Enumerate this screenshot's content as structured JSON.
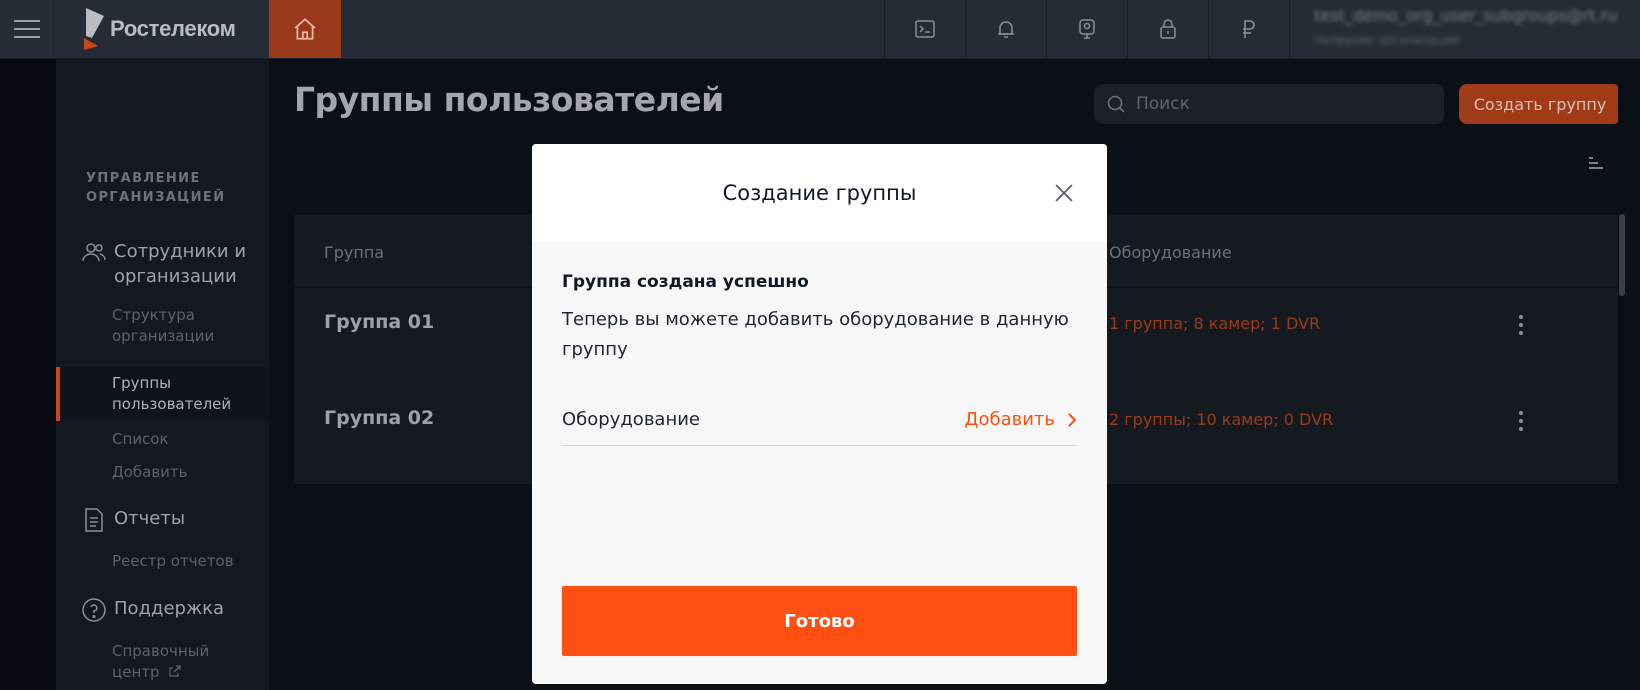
{
  "header": {
    "brand": "Ростелеком",
    "user_name": "test_demo_org_user_subgroups@rt.ru",
    "user_org": "Название организации",
    "icons": [
      "terminal-icon",
      "bell-icon",
      "camera-icon",
      "lock-icon",
      "ruble-icon"
    ]
  },
  "sidebar": {
    "section_title": "Управление организацией",
    "groups": [
      {
        "label": "Сотрудники и организации",
        "icon": "users-icon",
        "items": [
          {
            "label": "Структура организации"
          },
          {
            "label": "Группы пользователей",
            "active": true
          },
          {
            "label": "Список"
          },
          {
            "label": "Добавить"
          }
        ]
      },
      {
        "label": "Отчеты",
        "icon": "document-icon",
        "items": [
          {
            "label": "Реестр отчетов"
          }
        ]
      },
      {
        "label": "Поддержка",
        "icon": "help-icon",
        "items": [
          {
            "label": "Справочный центр"
          }
        ]
      }
    ]
  },
  "main": {
    "title": "Группы пользователей",
    "search_placeholder": "Поиск",
    "create_button": "Создать группу",
    "table": {
      "columns": [
        "Группа",
        "Оборудование"
      ],
      "rows": [
        {
          "name": "Группа 01",
          "equipment": "1 группа; 8 камер; 1 DVR"
        },
        {
          "name": "Группа 02",
          "equipment": "2 группы; 10 камер; 0 DVR"
        }
      ]
    }
  },
  "modal": {
    "title": "Создание группы",
    "success_title": "Группа создана успешно",
    "success_text": "Теперь вы можете добавить оборудование в данную группу",
    "equipment_label": "Оборудование",
    "add_label": "Добавить",
    "done_button": "Готово"
  },
  "colors": {
    "accent": "#ff4f12",
    "accent_dimmed": "#a13a16",
    "sidebar_bg": "#141920",
    "header_bg": "#262c35"
  }
}
